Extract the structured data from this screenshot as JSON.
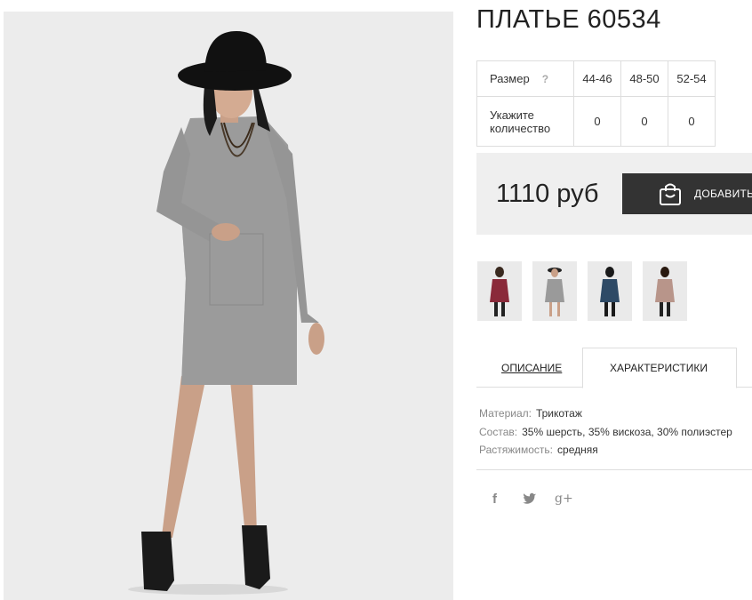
{
  "product": {
    "title": "ПЛАТЬЕ 60534",
    "sizes_label": "Размер",
    "help_mark": "?",
    "sizes": [
      "44-46",
      "48-50",
      "52-54"
    ],
    "quantity_label_line1": "Укажите",
    "quantity_label_line2": "количество",
    "quantities": [
      "0",
      "0",
      "0"
    ],
    "price": "1110 руб",
    "add_button": "ДОБАВИТЬ"
  },
  "color_variants": [
    {
      "name": "burgundy",
      "color": "#8a2a3a"
    },
    {
      "name": "grey",
      "color": "#9a9a9a"
    },
    {
      "name": "navy",
      "color": "#2e4a66"
    },
    {
      "name": "beige",
      "color": "#b8958a"
    }
  ],
  "tabs": {
    "description": "ОПИСАНИЕ",
    "characteristics": "ХАРАКТЕРИСТИКИ"
  },
  "specs": [
    {
      "key": "Материал:",
      "value": "Трикотаж"
    },
    {
      "key": "Состав:",
      "value": "35% шерсть, 35% вискоза, 30% полиэстер"
    },
    {
      "key": "Растяжимость:",
      "value": "средняя"
    }
  ],
  "social": {
    "facebook": "f",
    "google": "g+"
  },
  "icons": [
    "bag-icon",
    "facebook-icon",
    "twitter-icon",
    "google-plus-icon"
  ]
}
